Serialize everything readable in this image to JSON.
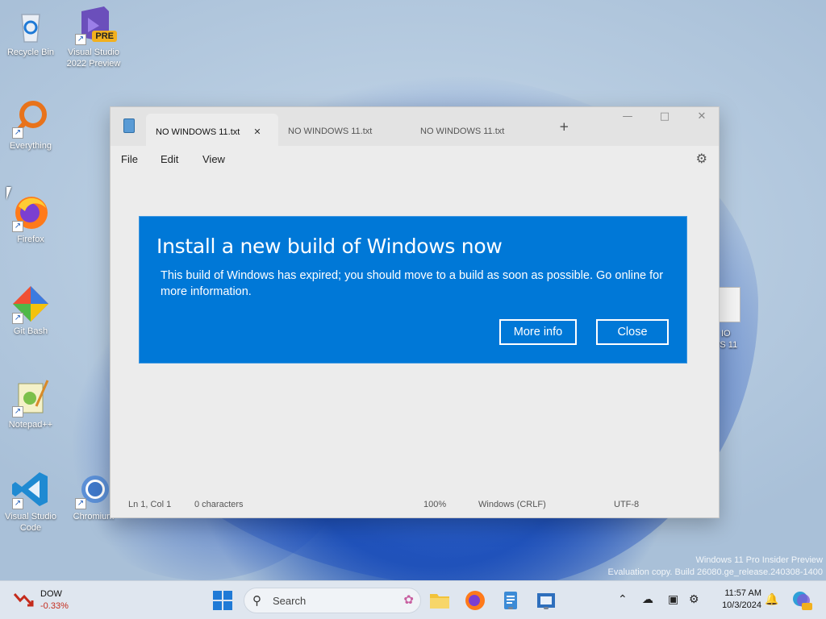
{
  "desktop": {
    "icons": [
      {
        "label": "Recycle Bin"
      },
      {
        "label": "Visual Studio 2022 Preview",
        "badge": "PRE"
      },
      {
        "label": "Everything"
      },
      {
        "label": "Firefox"
      },
      {
        "label": "Git Bash"
      },
      {
        "label": "Notepad++"
      },
      {
        "label": "Visual Studio Code"
      },
      {
        "label": "Chromium"
      }
    ],
    "partial_file_label_line1": "IO",
    "partial_file_label_line2": "WS 11",
    "watermark_line1": "Windows 11 Pro Insider Preview",
    "watermark_line2": "Evaluation copy. Build 26080.ge_release.240308-1400"
  },
  "notepad": {
    "tabs": [
      {
        "label": "NO WINDOWS 11.txt",
        "close": "✕"
      },
      {
        "label": "NO WINDOWS 11.txt"
      },
      {
        "label": "NO WINDOWS 11.txt"
      }
    ],
    "new_tab": "+",
    "menu": {
      "file": "File",
      "edit": "Edit",
      "view": "View"
    },
    "status": {
      "position": "Ln 1, Col 1",
      "chars": "0 characters",
      "zoom": "100%",
      "line_endings": "Windows (CRLF)",
      "encoding": "UTF-8"
    }
  },
  "dialog": {
    "title": "Install a new build of Windows now",
    "message": "This build of Windows has expired; you should move to a build as soon as possible. Go online for more information.",
    "more_info_label": "More info",
    "close_label": "Close",
    "background_color": "#0078d7"
  },
  "taskbar": {
    "widget": {
      "title": "DOW",
      "change": "-0.33%"
    },
    "search_placeholder": "Search",
    "time": "11:57 AM",
    "date": "10/3/2024",
    "icons": [
      "start-icon",
      "search-icon",
      "file-explorer-icon",
      "firefox-icon",
      "notepad-icon",
      "app-icon",
      "chevron-up-icon",
      "onedrive-icon",
      "display-icon",
      "accessibility-icon",
      "bell-icon",
      "copilot-icon"
    ]
  }
}
